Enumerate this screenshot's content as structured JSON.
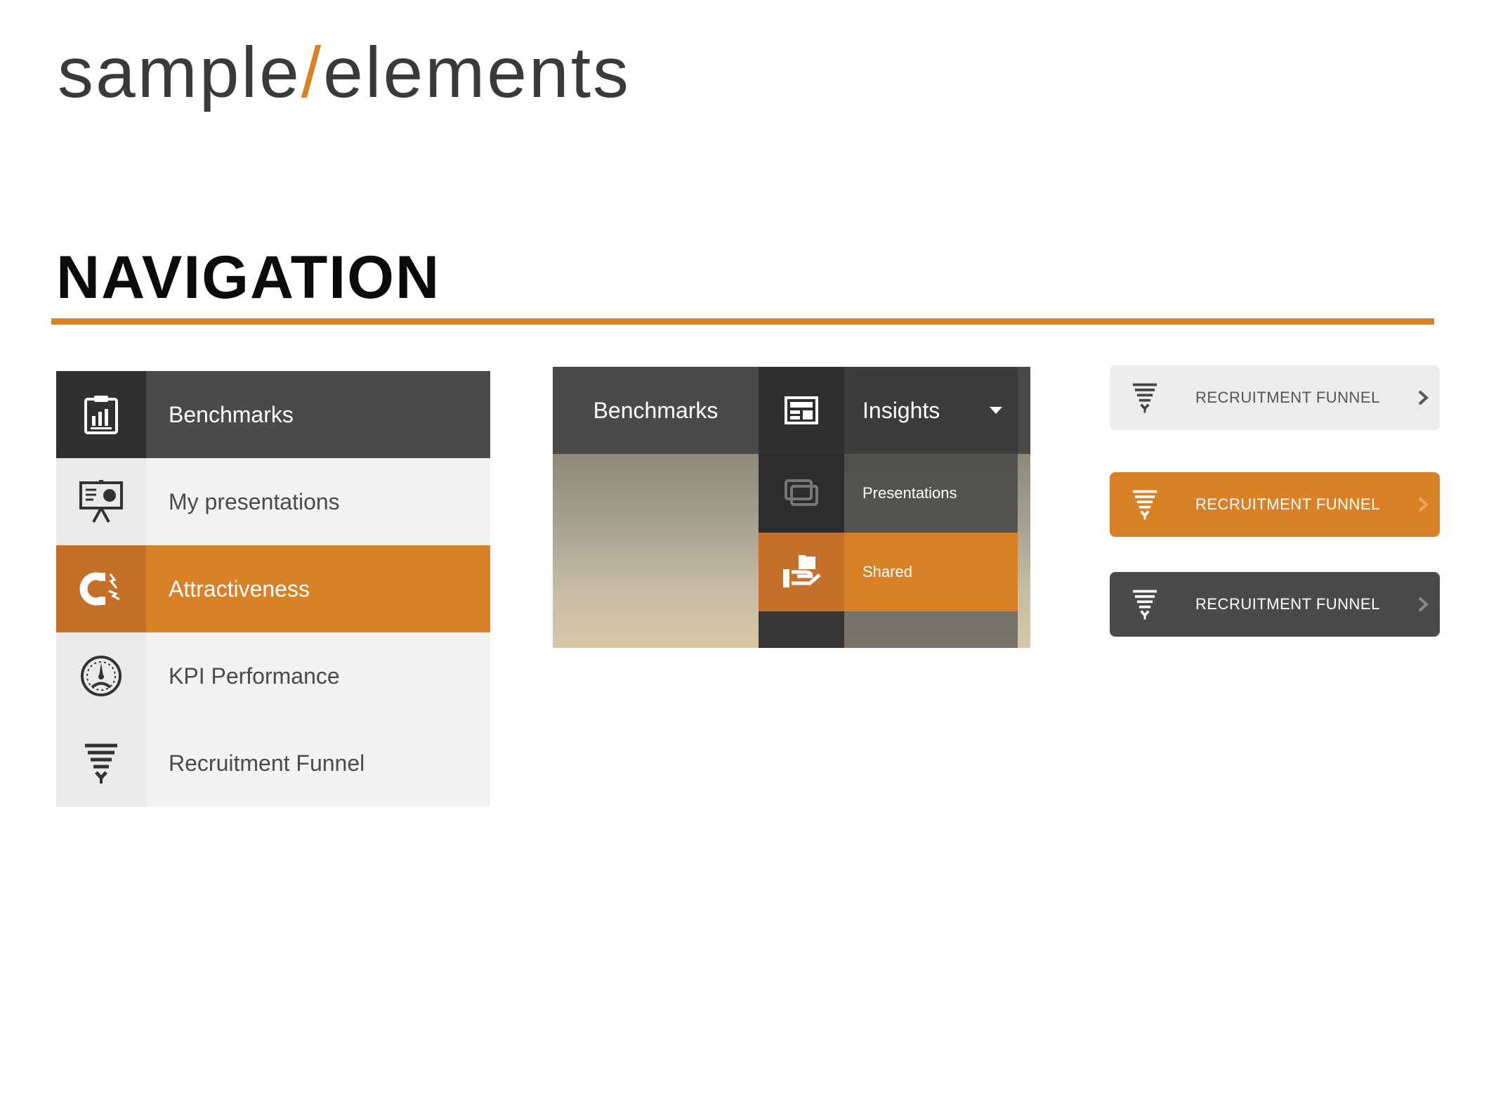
{
  "header": {
    "title_left": "sample",
    "title_slash": "/",
    "title_right": "elements"
  },
  "section": {
    "heading": "NAVIGATION"
  },
  "colors": {
    "accent": "#d98127",
    "dark": "#4a4a4a",
    "light": "#f2f2f2"
  },
  "sidebar": {
    "items": [
      {
        "label": "Benchmarks",
        "icon": "clipboard-chart-icon"
      },
      {
        "label": "My presentations",
        "icon": "presentation-board-icon"
      },
      {
        "label": "Attractiveness",
        "icon": "magnet-icon"
      },
      {
        "label": "KPI Performance",
        "icon": "gauge-icon"
      },
      {
        "label": "Recruitment Funnel",
        "icon": "funnel-icon"
      }
    ]
  },
  "topmenu": {
    "benchmarks": "Benchmarks",
    "insights": "Insights",
    "dropdown": [
      {
        "label": "Presentations",
        "icon": "stacked-windows-icon"
      },
      {
        "label": "Shared",
        "icon": "share-hand-icon"
      }
    ]
  },
  "funnel_buttons": {
    "light_label": "RECRUITMENT FUNNEL",
    "orange_label": "RECRUITMENT FUNNEL",
    "dark_label": "RECRUITMENT FUNNEL"
  }
}
